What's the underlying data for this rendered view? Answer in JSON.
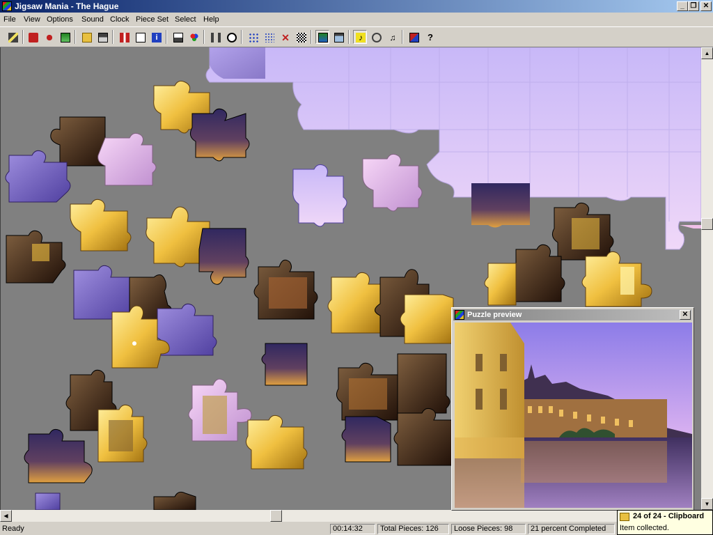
{
  "window": {
    "title": "Jigsaw Mania - The Hague",
    "minimize": "_",
    "restore": "❐",
    "close": "✕"
  },
  "menu": [
    "File",
    "View",
    "Options",
    "Sound",
    "Clock",
    "Piece Set",
    "Select",
    "Help"
  ],
  "toolbar_icons": [
    "magic-wand-icon",
    "new-puzzle-icon",
    "scatter-icon",
    "picture-icon",
    "open-icon",
    "save-icon",
    "gift-icon",
    "mail-icon",
    "info-icon",
    "properties-icon",
    "colors-icon",
    "timer-icon",
    "clock-icon",
    "grid-icon",
    "grid-select-icon",
    "delete-icon",
    "pattern-icon",
    "background-icon",
    "preview-icon",
    "music-icon",
    "sound-icon",
    "sound-settings-icon",
    "windows-icon",
    "help-icon"
  ],
  "preview": {
    "title": "Puzzle preview",
    "close": "✕"
  },
  "status": {
    "ready": "Ready",
    "time": "00:14:32",
    "total": "Total Pieces: 126",
    "loose": "Loose Pieces: 98",
    "percent": "21 percent Completed"
  },
  "notification": {
    "title": "24 of 24 - Clipboard",
    "text": "Item collected."
  },
  "colors": {
    "board": "#808080",
    "sky_light": "#f0d8f8",
    "sky_mid": "#c8b8f8",
    "gold": "#f0c040",
    "purple": "#7060c0",
    "dark": "#302010"
  },
  "puzzle": {
    "total_pieces": 126,
    "loose_pieces": 98,
    "percent_completed": 21
  }
}
